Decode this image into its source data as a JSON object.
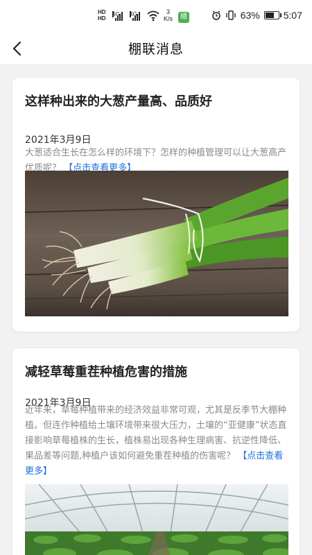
{
  "status_bar": {
    "hd_top": "HD",
    "hd_bottom": "HD",
    "sig1_label": "4G",
    "sig2_label": "4G",
    "speed_value": "3",
    "speed_unit": "K/s",
    "app_badge": "顺",
    "battery_percent": "63%",
    "battery_level": 0.63,
    "time": "5:07"
  },
  "nav": {
    "title": "棚联消息"
  },
  "articles": [
    {
      "title": "这样种出来的大葱产量高、品质好",
      "date": "2021年3月9日",
      "description": "大葱适合生长在怎么样的环境下？怎样的种植管理可以让大葱高产优质呢？",
      "more_link": "【点击查看更多】",
      "image_icon": "green-onion-photo"
    },
    {
      "title": "减轻草莓重茬种植危害的措施",
      "date": "2021年3月9日",
      "description": "近年来，草莓种植带来的经济效益非常可观，尤其是反季节大棚种植。但连作种植给土壤环境带来很大压力，土壤的“亚健康”状态直接影响草莓植株的生长，植株易出现各种生理病害、抗逆性降低、果品差等问题,种植户该如何避免重茬种植的伤害呢？",
      "more_link": "【点击查看更多】",
      "image_icon": "greenhouse-photo"
    }
  ]
}
